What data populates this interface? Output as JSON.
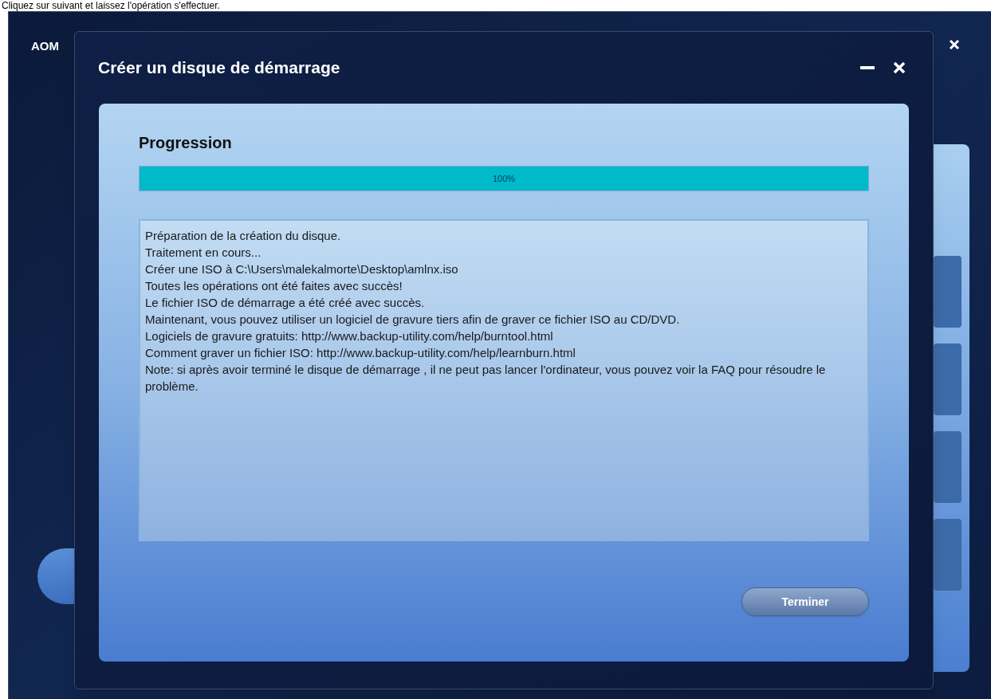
{
  "caption": "Cliquez sur suivant et laissez l'opération s'effectuer.",
  "background_window": {
    "title": "AOM"
  },
  "dialog": {
    "title": "Créer un disque de démarrage",
    "section_title": "Progression",
    "progress": {
      "level": 1.0,
      "label": "100%"
    },
    "log": [
      "Préparation de la création du disque.",
      "Traitement en cours...",
      "Créer une ISO à C:\\Users\\malekalmorte\\Desktop\\amlnx.iso",
      "Toutes les opérations ont été faites avec succès!",
      "Le fichier ISO de démarrage a été créé avec succès.",
      "Maintenant, vous pouvez utiliser un logiciel de gravure tiers afin de graver ce fichier ISO au CD/DVD.",
      "Logiciels de gravure gratuits: http://www.backup-utility.com/help/burntool.html",
      "Comment graver un fichier ISO: http://www.backup-utility.com/help/learnburn.html",
      "Note: si après avoir terminé le disque de démarrage , il ne peut pas lancer l'ordinateur, vous pouvez voir la FAQ pour résoudre le problème."
    ],
    "buttons": [
      "Terminer"
    ]
  }
}
